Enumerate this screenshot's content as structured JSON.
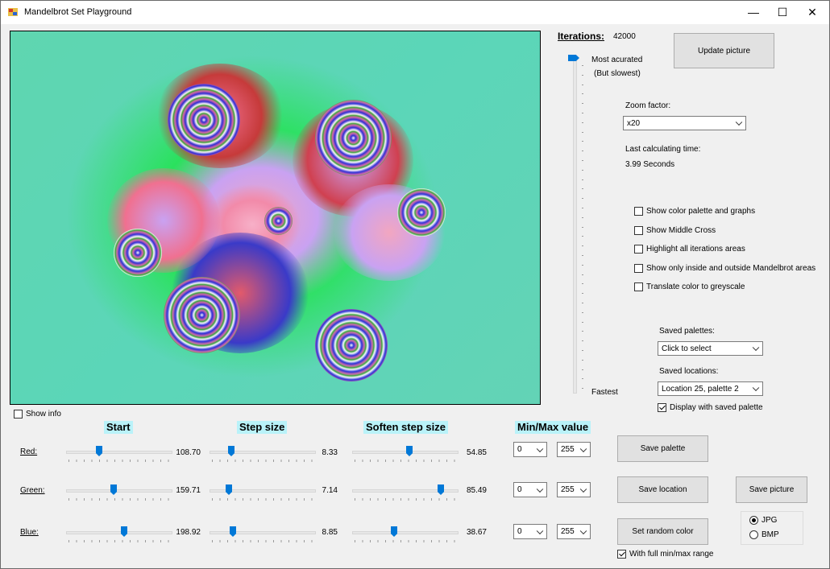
{
  "window": {
    "title": "Mandelbrot Set Playground",
    "minimize": "—",
    "maximize": "☐",
    "close": "✕"
  },
  "iterations": {
    "label": "Iterations:",
    "value": "42000"
  },
  "update_button": "Update picture",
  "slider": {
    "most_label": "Most acurated",
    "most_sub": "(But slowest)",
    "fastest_label": "Fastest"
  },
  "zoom": {
    "label": "Zoom factor:",
    "value": "x20"
  },
  "calc": {
    "label": "Last calculating time:",
    "value": "3.99 Seconds"
  },
  "options": [
    {
      "label": "Show color palette and graphs",
      "checked": false
    },
    {
      "label": "Show Middle Cross",
      "checked": false
    },
    {
      "label": "Highlight all iterations areas",
      "checked": false
    },
    {
      "label": "Show only inside and outside Mandelbrot areas",
      "checked": false
    },
    {
      "label": "Translate color to greyscale",
      "checked": false
    }
  ],
  "saved_palettes": {
    "label": "Saved palettes:",
    "value": "Click to select"
  },
  "saved_locations": {
    "label": "Saved locations:",
    "value": "Location 25, palette 2"
  },
  "display_saved_palette": {
    "label": "Display with saved palette",
    "checked": true
  },
  "show_info": {
    "label": "Show info",
    "checked": false
  },
  "headers": {
    "start": "Start",
    "step": "Step size",
    "soften": "Soften step size",
    "minmax": "Min/Max value"
  },
  "rows": [
    {
      "label": "Red:",
      "start": "108.70",
      "step": "8.33",
      "soften": "54.85",
      "min": "0",
      "max": "255"
    },
    {
      "label": "Green:",
      "start": "159.71",
      "step": "7.14",
      "soften": "85.49",
      "min": "0",
      "max": "255"
    },
    {
      "label": "Blue:",
      "start": "198.92",
      "step": "8.85",
      "soften": "38.67",
      "min": "0",
      "max": "255"
    }
  ],
  "buttons": {
    "save_palette": "Save  palette",
    "save_location": "Save location",
    "save_picture": "Save picture",
    "random_color": "Set random color"
  },
  "full_range": {
    "label": "With full min/max range",
    "checked": true
  },
  "format": {
    "jpg": "JPG",
    "bmp": "BMP",
    "selected": "JPG"
  }
}
